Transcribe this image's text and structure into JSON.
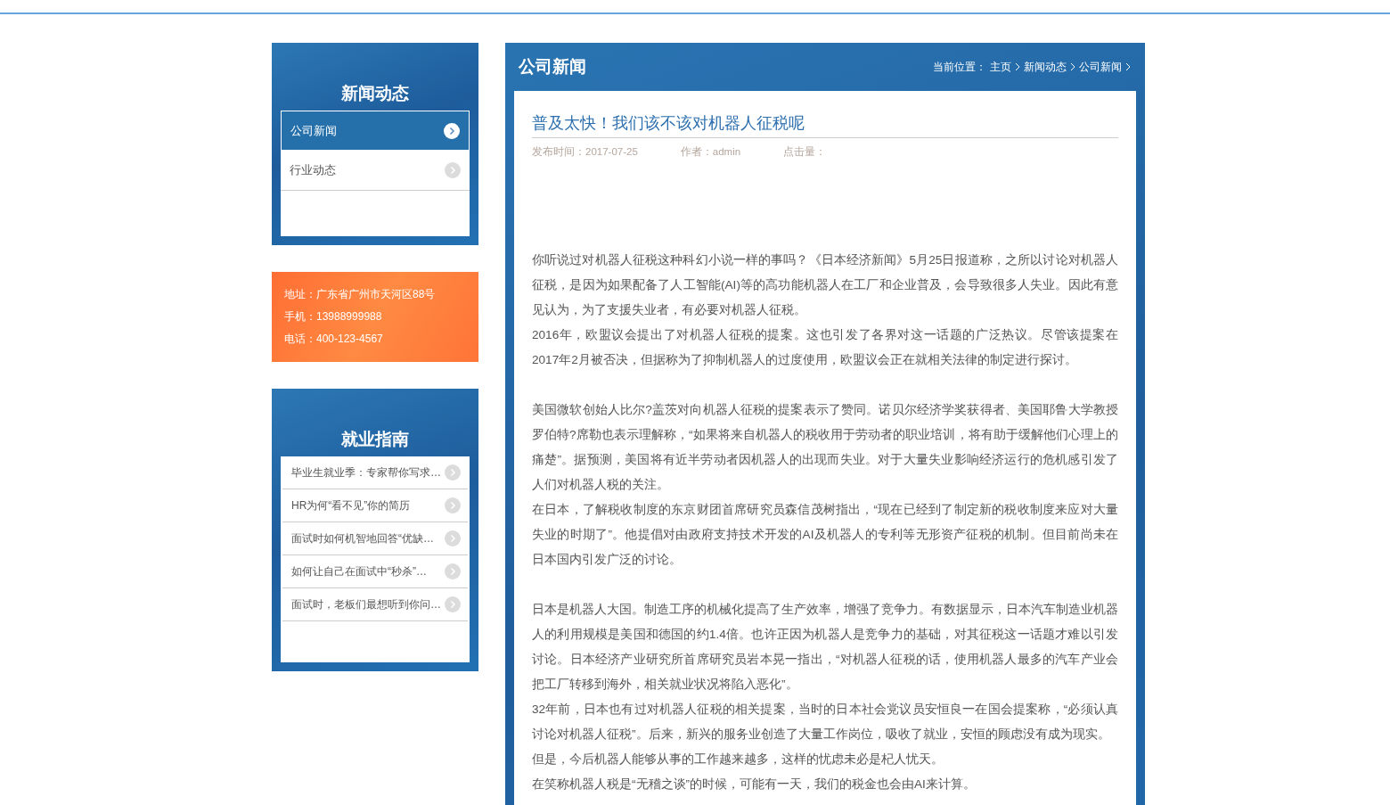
{
  "sidebar": {
    "news_panel": {
      "title": "新闻动态",
      "items": [
        {
          "label": "公司新闻",
          "selected": true
        },
        {
          "label": "行业动态",
          "selected": false
        }
      ]
    },
    "contact": [
      {
        "label": "地址：",
        "value": "广东省广州市天河区88号"
      },
      {
        "label": "手机：",
        "value": "13988999988"
      },
      {
        "label": "电话：",
        "value": "400-123-4567"
      }
    ],
    "guide_panel": {
      "title": "就业指南",
      "items": [
        {
          "label": "毕业生就业季：专家帮你写求…"
        },
        {
          "label": "HR为何“看不见”你的简历"
        },
        {
          "label": "面试时如何机智地回答“优缺…"
        },
        {
          "label": "如何让自己在面试中“秒杀”…"
        },
        {
          "label": "面试时，老板们最想听到你问…"
        }
      ]
    }
  },
  "main": {
    "title": "公司新闻",
    "breadcrumb": {
      "prefix": "当前位置：",
      "items": [
        "主页",
        "新闻动态",
        "公司新闻"
      ]
    },
    "article": {
      "title": "普及太快！我们该不该对机器人征税呢",
      "meta": [
        {
          "label": "发布时间：",
          "value": "2017-07-25"
        },
        {
          "label": "作者：",
          "value": "admin"
        },
        {
          "label": "点击量："
        }
      ],
      "sections": [
        [
          "你听说过对机器人征税这种科幻小说一样的事吗？《日本经济新闻》5月25日报道称，之所以讨论对机器人征税，是因为如果配备了人工智能(AI)等的高功能机器人在工厂和企业普及，会导致很多人失业。因此有意见认为，为了支援失业者，有必要对机器人征税。",
          "2016年，欧盟议会提出了对机器人征税的提案。这也引发了各界对这一话题的广泛热议。尽管该提案在2017年2月被否决，但据称为了抑制机器人的过度使用，欧盟议会正在就相关法律的制定进行探讨。"
        ],
        [
          "美国微软创始人比尔?盖茨对向机器人征税的提案表示了赞同。诺贝尔经济学奖获得者、美国耶鲁大学教授罗伯特?席勒也表示理解称，“如果将来自机器人的税收用于劳动者的职业培训，将有助于缓解他们心理上的痛楚”。据预测，美国将有近半劳动者因机器人的出现而失业。对于大量失业影响经济运行的危机感引发了人们对机器人税的关注。",
          "在日本，了解税收制度的东京财团首席研究员森信茂树指出，“现在已经到了制定新的税收制度来应对大量失业的时期了”。他提倡对由政府支持技术开发的AI及机器人的专利等无形资产征税的机制。但目前尚未在日本国内引发广泛的讨论。"
        ],
        [
          "日本是机器人大国。制造工序的机械化提高了生产效率，增强了竞争力。有数据显示，日本汽车制造业机器人的利用规模是美国和德国的约1.4倍。也许正因为机器人是竞争力的基础，对其征税这一话题才难以引发讨论。日本经济产业研究所首席研究员岩本晃一指出，“对机器人征税的话，使用机器人最多的汽车产业会把工厂转移到海外，相关就业状况将陷入恶化”。",
          "32年前，日本也有过对机器人征税的相关提案，当时的日本社会党议员安恒良一在国会提案称，“必须认真讨论对机器人征税”。后来，新兴的服务业创造了大量工作岗位，吸收了就业，安恒的顾虑没有成为现实。",
          "但是，今后机器人能够从事的工作越来越多，这样的忧虑未必是杞人忧天。",
          "在笑称机器人税是“无稽之谈”的时候，可能有一天，我们的税金也会由AI来计算。"
        ]
      ]
    }
  }
}
